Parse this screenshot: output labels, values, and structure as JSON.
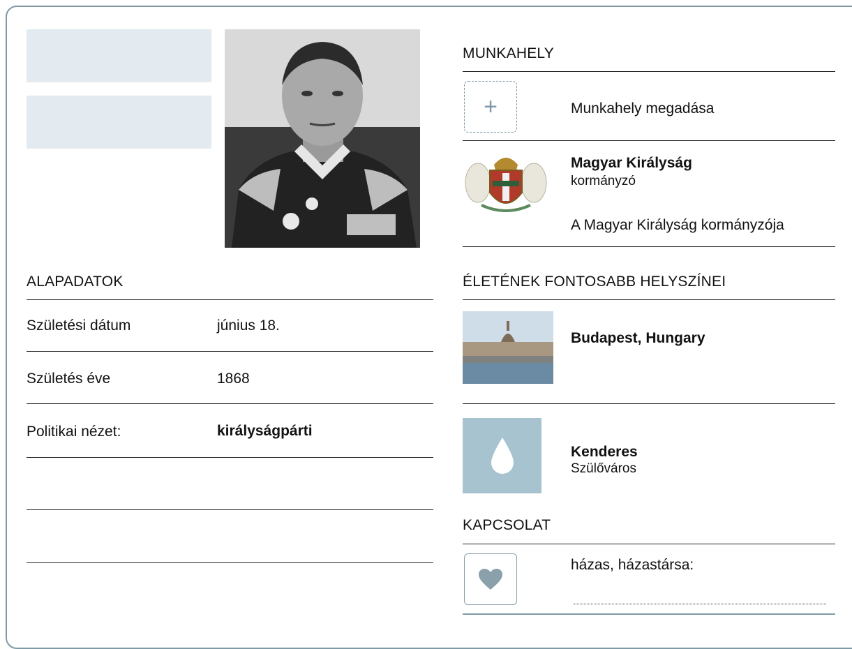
{
  "alapadatok": {
    "title": "ALAPADATOK",
    "rows": [
      {
        "label": "Születési dátum",
        "value": "június 18."
      },
      {
        "label": "Születés éve",
        "value": "1868"
      },
      {
        "label": "Politikai nézet:",
        "value": "királyságpárti"
      }
    ]
  },
  "munkahely": {
    "title": "MUNKAHELY",
    "add_label": "Munkahely megadása",
    "entries": [
      {
        "name": "Magyar Királyság",
        "role": "kormányzó",
        "description": "A Magyar Királyság kormányzója"
      }
    ]
  },
  "helyszinek": {
    "title": "ÉLETÉNEK FONTOSABB HELYSZÍNEI",
    "items": [
      {
        "name": "Budapest, Hungary",
        "subtitle": ""
      },
      {
        "name": "Kenderes",
        "subtitle": "Szülőváros"
      }
    ]
  },
  "kapcsolat": {
    "title": "KAPCSOLAT",
    "status": "házas, házastársa:"
  },
  "colors": {
    "accent": "#7f9aa6",
    "placeholder": "#e3ebf0",
    "drop_bg": "#a8c3d0"
  }
}
